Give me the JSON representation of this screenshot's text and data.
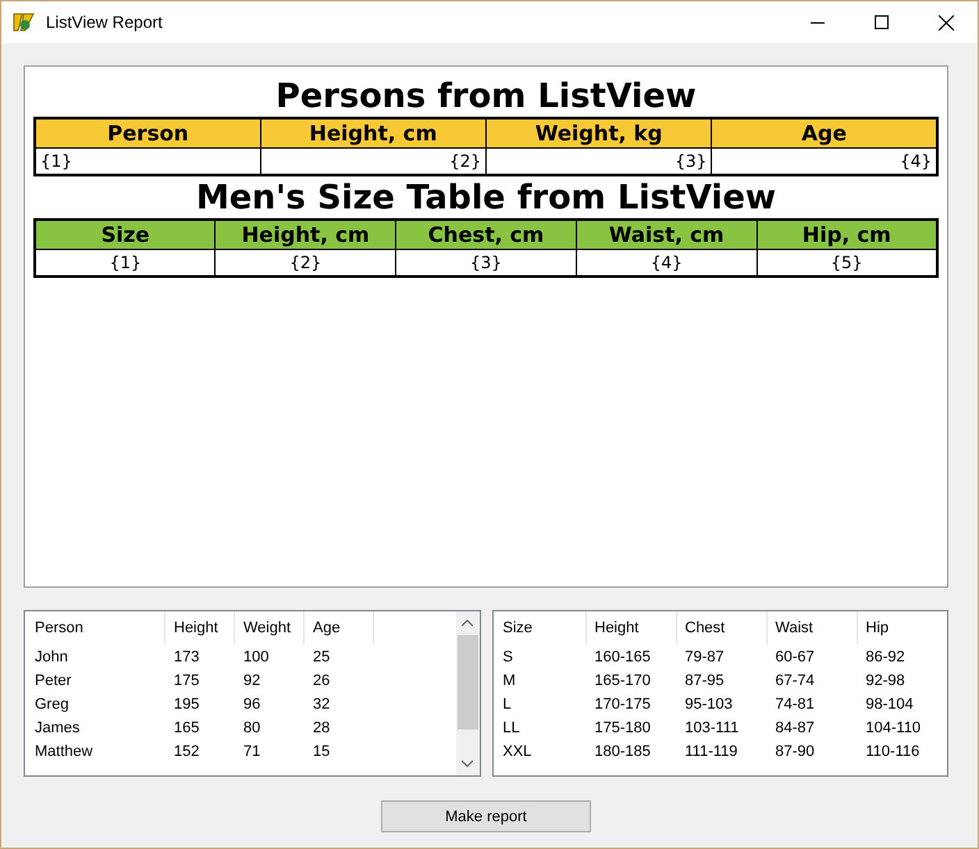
{
  "window": {
    "title": "ListView Report"
  },
  "report": {
    "tables": [
      {
        "title": "Persons from ListView",
        "color": "#f7c937",
        "columns": [
          {
            "label": "Person",
            "cell": "{1}"
          },
          {
            "label": "Height, cm",
            "cell": "{2}"
          },
          {
            "label": "Weight, kg",
            "cell": "{3}"
          },
          {
            "label": "Age",
            "cell": "{4}"
          }
        ]
      },
      {
        "title": "Men's Size Table from ListView",
        "color": "#88c442",
        "columns": [
          {
            "label": "Size",
            "cell": "{1}"
          },
          {
            "label": "Height, cm",
            "cell": "{2}"
          },
          {
            "label": "Chest, cm",
            "cell": "{3}"
          },
          {
            "label": "Waist, cm",
            "cell": "{4}"
          },
          {
            "label": "Hip, cm",
            "cell": "{5}"
          }
        ]
      }
    ]
  },
  "lists": [
    {
      "scrollbar": true,
      "columns": [
        "Person",
        "Height",
        "Weight",
        "Age"
      ],
      "rows": [
        [
          "John",
          "173",
          "100",
          "25"
        ],
        [
          "Peter",
          "175",
          "92",
          "26"
        ],
        [
          "Greg",
          "195",
          "96",
          "32"
        ],
        [
          "James",
          "165",
          "80",
          "28"
        ],
        [
          "Matthew",
          "152",
          "71",
          "15"
        ]
      ]
    },
    {
      "columns": [
        "Size",
        "Height",
        "Chest",
        "Waist",
        "Hip"
      ],
      "rows": [
        [
          "S",
          "160-165",
          "79-87",
          "60-67",
          "86-92"
        ],
        [
          "M",
          "165-170",
          "87-95",
          "67-74",
          "92-98"
        ],
        [
          "L",
          "170-175",
          "95-103",
          "74-81",
          "98-104"
        ],
        [
          "LL",
          "175-180",
          "103-111",
          "84-87",
          "104-110"
        ],
        [
          "XXL",
          "180-185",
          "111-119",
          "87-90",
          "110-116"
        ]
      ]
    }
  ],
  "button": {
    "label": "Make report"
  }
}
